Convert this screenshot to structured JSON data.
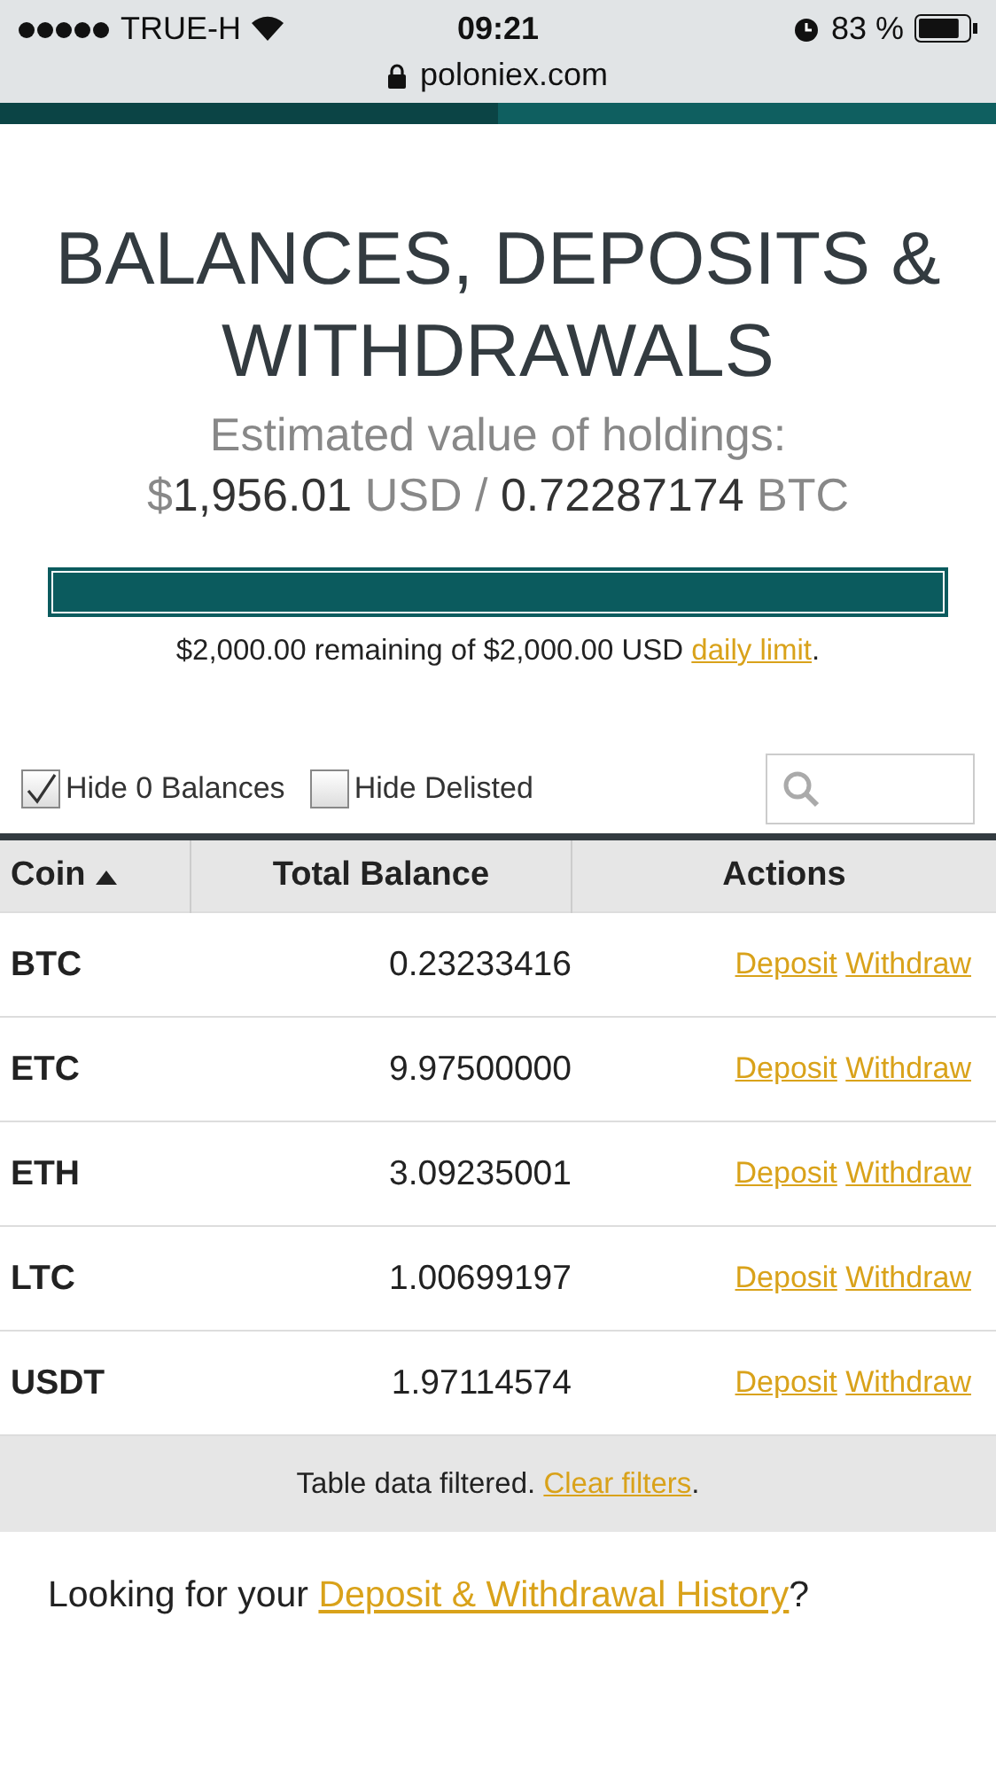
{
  "status_bar": {
    "carrier": "TRUE-H",
    "time": "09:21",
    "battery": "83 %"
  },
  "address_bar": {
    "url": "poloniex.com",
    "level": 0.5
  },
  "title": "BALANCES, DEPOSITS & WITHDRAWALS",
  "estimate": {
    "label": "Estimated value of holdings:",
    "usd_symbol": "$",
    "usd_value": "1,956.01",
    "usd_unit": "USD /",
    "btc_value": "0.72287174",
    "btc_unit": "BTC"
  },
  "limit": {
    "level": 1,
    "text": "$2,000.00 remaining of $2,000.00 USD",
    "link": "daily limit",
    "end": "."
  },
  "filters": [
    {
      "label": "Hide 0 Balances",
      "checked": true
    },
    {
      "label": "Hide Delisted",
      "checked": false
    }
  ],
  "table": {
    "columns": [
      "Coin",
      "Total Balance",
      "Actions"
    ],
    "rows": [
      {
        "coin": "BTC",
        "balance": "0.23233416",
        "actions": [
          "Deposit",
          "Withdraw"
        ]
      },
      {
        "coin": "ETC",
        "balance": "9.97500000",
        "actions": [
          "Deposit",
          "Withdraw"
        ]
      },
      {
        "coin": "ETH",
        "balance": "3.09235001",
        "actions": [
          "Deposit",
          "Withdraw"
        ]
      },
      {
        "coin": "LTC",
        "balance": "1.00699197",
        "actions": [
          "Deposit",
          "Withdraw"
        ]
      },
      {
        "coin": "USDT",
        "balance": "1.97114574",
        "actions": [
          "Deposit",
          "Withdraw"
        ]
      }
    ],
    "footer": {
      "text": "Table data filtered.",
      "link": "Clear filters",
      "end": "."
    }
  },
  "history": {
    "text": "Looking for your",
    "link": "Deposit & Withdrawal History",
    "end": "?"
  }
}
